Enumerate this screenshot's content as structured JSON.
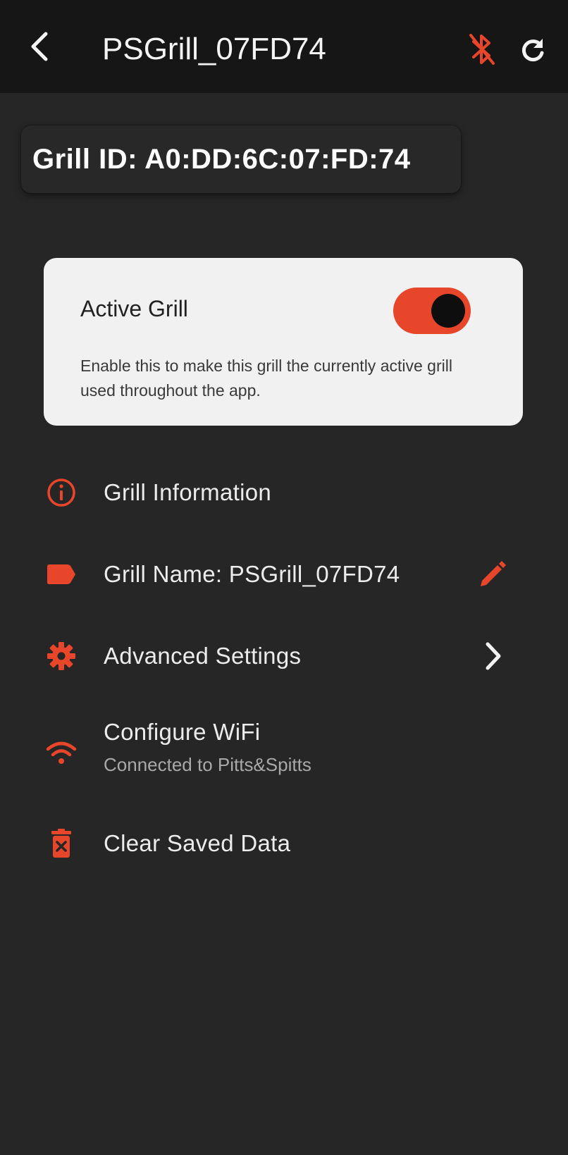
{
  "header": {
    "title": "PSGrill_07FD74",
    "back_icon": "chevron-left-icon",
    "bluetooth_icon": "bluetooth-off-icon",
    "refresh_icon": "refresh-icon"
  },
  "grill_id": {
    "text": "Grill ID: A0:DD:6C:07:FD:74"
  },
  "active_card": {
    "title": "Active Grill",
    "description": "Enable this to make this grill the currently active grill used throughout the app.",
    "toggle_on": true
  },
  "menu": {
    "items": [
      {
        "label": "Grill Information",
        "icon": "info-icon"
      },
      {
        "label": "Grill Name: PSGrill_07FD74",
        "icon": "tag-icon",
        "trailing_icon": "pencil-icon"
      },
      {
        "label": "Advanced Settings",
        "icon": "gear-icon",
        "trailing_icon": "chevron-right-icon"
      },
      {
        "label": "Configure WiFi",
        "subtitle": "Connected to Pitts&Spitts",
        "icon": "wifi-icon"
      },
      {
        "label": "Clear Saved Data",
        "icon": "trash-icon"
      }
    ]
  },
  "colors": {
    "accent": "#E8462A",
    "background": "#262626",
    "header": "#161616",
    "card": "#F1F1F1"
  }
}
